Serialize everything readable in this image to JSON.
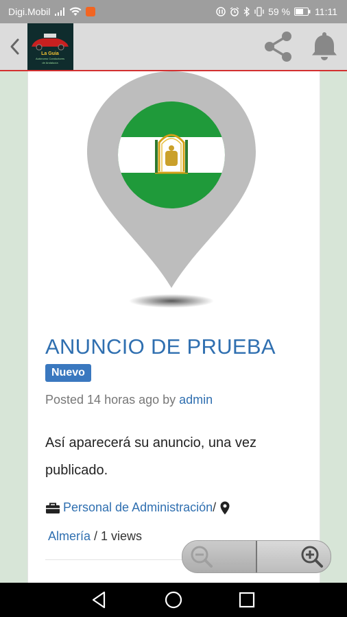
{
  "status_bar": {
    "carrier": "Digi.Mobil",
    "battery_percent": "59 %",
    "time": "11:11"
  },
  "app_bar": {
    "logo_text_line1": "La Guia",
    "logo_text_line2": "Autónomo Conductores",
    "logo_text_line3": "de Andalucía"
  },
  "listing": {
    "title": "ANUNCIO DE PRUEBA",
    "badge": "Nuevo",
    "posted_prefix": "Posted 14 horas ago by ",
    "author": "admin",
    "description": "Así aparecerá su anuncio, una vez publicado.",
    "category": "Personal de Administración",
    "separator": " / ",
    "location": "Almería",
    "views": " / 1 views"
  },
  "colors": {
    "accent": "#2f6fb0",
    "badge": "#3a78bf",
    "appbar_line": "#d32f2f",
    "flag_green": "#1f9a3a"
  }
}
